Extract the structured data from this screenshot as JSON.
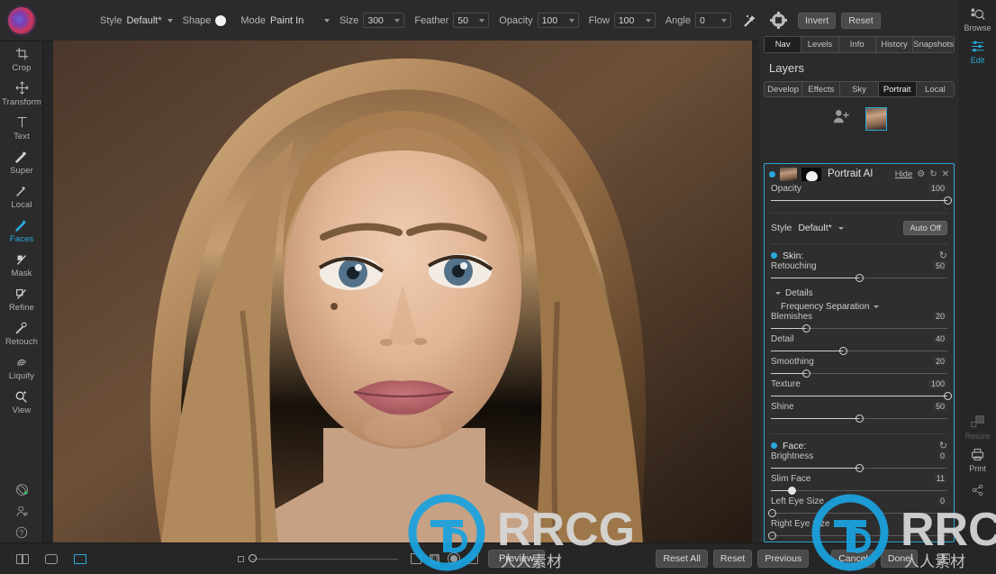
{
  "app": {
    "logo_icon": "topaz-logo-icon"
  },
  "toolbar": {
    "style_label": "Style",
    "style_value": "Default*",
    "shape_label": "Shape",
    "shape_icon": "brush-shape-circle-icon",
    "mode_label": "Mode",
    "mode_value": "Paint In",
    "size_label": "Size",
    "size_value": "300",
    "feather_label": "Feather",
    "feather_value": "50",
    "opacity_label": "Opacity",
    "opacity_value": "100",
    "flow_label": "Flow",
    "flow_value": "100",
    "angle_label": "Angle",
    "angle_value": "0",
    "wand_icon": "magic-wand-icon",
    "settings_icon": "gear-icon",
    "invert_label": "Invert",
    "reset_label": "Reset"
  },
  "left_tools": [
    {
      "label": "Crop",
      "icon": "crop-icon",
      "active": false
    },
    {
      "label": "Transform",
      "icon": "transform-move-icon",
      "active": false
    },
    {
      "label": "Text",
      "icon": "text-icon",
      "active": false
    },
    {
      "label": "Super",
      "icon": "super-wand-icon",
      "active": false
    },
    {
      "label": "Local",
      "icon": "local-brush-icon",
      "active": false
    },
    {
      "label": "Faces",
      "icon": "faces-brush-icon",
      "active": true
    },
    {
      "label": "Mask",
      "icon": "mask-brush-icon",
      "active": false
    },
    {
      "label": "Refine",
      "icon": "refine-brush-icon",
      "active": false
    },
    {
      "label": "Retouch",
      "icon": "retouch-icon",
      "active": false
    },
    {
      "label": "Liquify",
      "icon": "liquify-icon",
      "active": false
    },
    {
      "label": "View",
      "icon": "view-zoom-icon",
      "active": false
    }
  ],
  "left_bottom_icons": [
    {
      "icon": "share-node-icon"
    },
    {
      "icon": "account-icon"
    },
    {
      "icon": "help-question-icon"
    }
  ],
  "bottom_bar": {
    "left_icons": [
      {
        "icon": "split-view-icon",
        "active": false
      },
      {
        "icon": "single-view-icon",
        "active": false
      },
      {
        "icon": "fit-view-icon",
        "active": true
      }
    ],
    "zoom_small_icon": "zoom-out-icon",
    "zoom_value_pos_pct": 4,
    "right_icons": [
      {
        "icon": "bounding-box-icon"
      },
      {
        "icon": "letter-a-icon"
      },
      {
        "icon": "circle-fill-icon"
      },
      {
        "icon": "checkbox-small-icon"
      }
    ],
    "preview_label": "Preview",
    "panel_toggle_icon": "right-panel-toggle-icon"
  },
  "right_panel": {
    "tabs": [
      {
        "label": "Nav",
        "active": true
      },
      {
        "label": "Levels",
        "active": false
      },
      {
        "label": "Info",
        "active": false
      },
      {
        "label": "History",
        "active": false
      },
      {
        "label": "Snapshots",
        "active": false
      }
    ],
    "title": "Layers",
    "segments": [
      {
        "label": "Develop",
        "active": false
      },
      {
        "label": "Effects",
        "active": false
      },
      {
        "label": "Sky",
        "active": false
      },
      {
        "label": "Portrait",
        "active": true
      },
      {
        "label": "Local",
        "active": false
      }
    ],
    "add_face_icon": "add-person-icon",
    "face_thumb_icon": "face-thumbnail",
    "layer": {
      "name": "Portrait AI",
      "hide_label": "Hide",
      "settings_icon": "gear-icon",
      "reset_icon": "revert-icon",
      "close_icon": "close-icon",
      "visibility_icon": "visibility-dot-icon",
      "thumb_icon": "layer-thumbnail",
      "mask_icon": "layer-mask-thumbnail",
      "opacity_label": "Opacity",
      "opacity_value": "100",
      "opacity_pct": 100,
      "style_label": "Style",
      "style_value": "Default*",
      "auto_label": "Auto Off"
    },
    "sections": [
      {
        "name": "Skin:",
        "revert_icon": "revert-icon",
        "sliders": [
          {
            "label": "Retouching",
            "value": "50",
            "pct": 50,
            "knob": "hollow"
          }
        ],
        "details_label": "Details",
        "details_icon": "chevron-down-icon",
        "method_label": "Frequency Separation",
        "method_icon": "chevron-down-icon",
        "detail_sliders": [
          {
            "label": "Blemishes",
            "value": "20",
            "pct": 20,
            "knob": "hollow"
          },
          {
            "label": "Detail",
            "value": "40",
            "pct": 40,
            "knob": "hollow"
          },
          {
            "label": "Smoothing",
            "value": "20",
            "pct": 20,
            "knob": "hollow"
          },
          {
            "label": "Texture",
            "value": "100",
            "pct": 100,
            "knob": "hollow"
          },
          {
            "label": "Shine",
            "value": "50",
            "pct": 50,
            "knob": "hollow"
          }
        ]
      },
      {
        "name": "Face:",
        "revert_icon": "revert-icon",
        "sliders": [
          {
            "label": "Brightness",
            "value": "0",
            "pct": 50,
            "knob": "hollow"
          },
          {
            "label": "Slim Face",
            "value": "11",
            "pct": 11,
            "knob": "solid"
          },
          {
            "label": "Left Eye Size",
            "value": "0",
            "pct": 0,
            "knob": "hollow"
          },
          {
            "label": "Right Eye Size",
            "value": "",
            "pct": 0,
            "knob": "hollow"
          }
        ],
        "details_label": "",
        "method_label": "",
        "detail_sliders": []
      }
    ]
  },
  "right_rail": [
    {
      "label": "Browse",
      "icon": "browse-icon",
      "state": "normal"
    },
    {
      "label": "Edit",
      "icon": "edit-sliders-icon",
      "state": "active"
    },
    {
      "label": "Resize",
      "icon": "resize-icon",
      "state": "dim"
    },
    {
      "label": "Print",
      "icon": "printer-icon",
      "state": "normal"
    },
    {
      "label": "",
      "icon": "share-node-icon",
      "state": "normal"
    }
  ],
  "footer_buttons": [
    {
      "label": "Reset All"
    },
    {
      "label": "Reset"
    },
    {
      "label": "Previous"
    },
    {
      "label": "Cancel"
    },
    {
      "label": "Done"
    }
  ],
  "watermarks": [
    {
      "text": "RRCG",
      "sub": "人人素材"
    },
    {
      "text": "RRCG",
      "sub": "人人素材"
    }
  ],
  "colors": {
    "accent": "#2aa9dc",
    "panel_bg": "#2b2b2b",
    "app_bg": "#262626",
    "text": "#c8c8c8",
    "watermark_blue": "#1aa3e0"
  }
}
